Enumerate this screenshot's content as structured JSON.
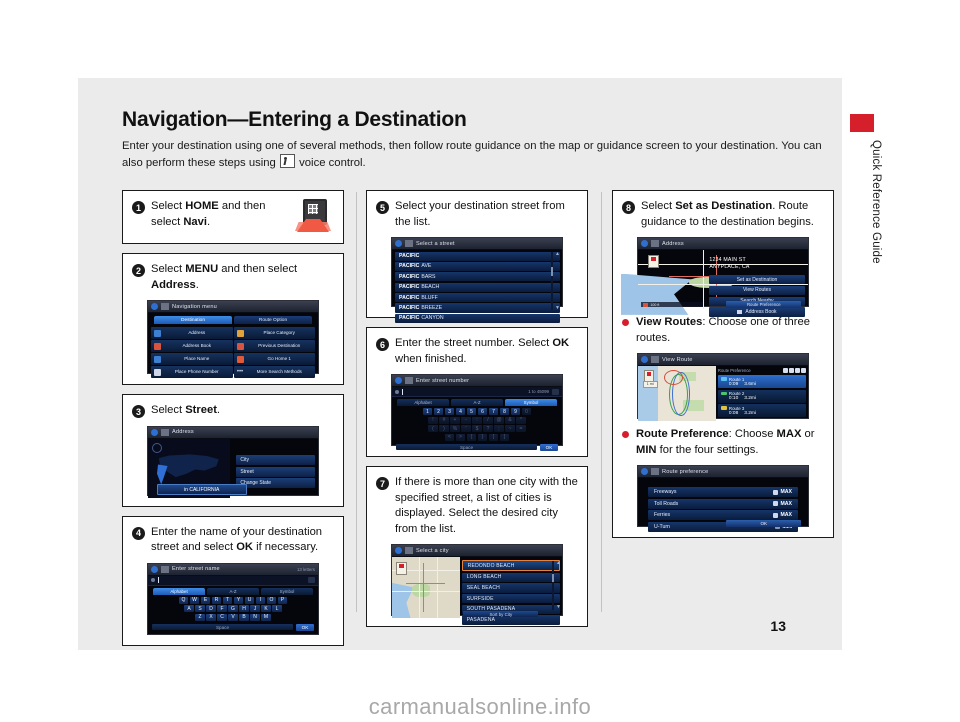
{
  "document": {
    "title": "Navigation—Entering a Destination",
    "intro": "Enter your destination using one of several methods, then follow route guidance on the map or guidance screen to your destination. You can also perform these steps using",
    "intro_tail": "voice control.",
    "page_number": "13",
    "sidebar_label": "Quick Reference Guide",
    "watermark": "carmanualsonline.info",
    "accent_red": "#d5202c"
  },
  "steps": {
    "s1": {
      "num": "1",
      "text_a": "Select ",
      "bold_a": "HOME",
      "text_b": " and then select ",
      "bold_b": "Navi",
      "text_c": "."
    },
    "s2": {
      "num": "2",
      "text_a": "Select ",
      "bold_a": "MENU",
      "text_b": " and then select ",
      "bold_b": "Address",
      "text_c": ".",
      "screen": {
        "title": "Navigation menu",
        "tabs": [
          "Destination",
          "Route Option"
        ],
        "active_tab": "Destination",
        "items": [
          "Address",
          "Place Category",
          "Address Book",
          "Previous Destination",
          "Place Name",
          "Go Home 1",
          "Place Phone Number",
          "More Search Methods"
        ]
      }
    },
    "s3": {
      "num": "3",
      "text_a": "Select ",
      "bold_a": "Street",
      "text_c": ".",
      "screen": {
        "title": "Address",
        "options": [
          "City",
          "Street",
          "Change State"
        ],
        "state_button": "in CALIFORNIA"
      }
    },
    "s4": {
      "num": "4",
      "text_a": "Enter the name of your destination street and select ",
      "bold_a": "OK",
      "text_c": " if necessary.",
      "screen": {
        "title": "Enter street name",
        "hint": "13 letters",
        "tabs": [
          "Alphabet",
          "A-Z",
          "Symbol"
        ],
        "active_tab": "Alphabet",
        "row1": [
          "Q",
          "W",
          "E",
          "R",
          "T",
          "Y",
          "U",
          "I",
          "O",
          "P"
        ],
        "row2": [
          "A",
          "S",
          "D",
          "F",
          "G",
          "H",
          "J",
          "K",
          "L"
        ],
        "row3": [
          "Z",
          "X",
          "C",
          "V",
          "B",
          "N",
          "M"
        ],
        "space_label": "Space",
        "ok_label": "OK"
      }
    },
    "s5": {
      "num": "5",
      "text_a": "Select your destination street from the list.",
      "screen": {
        "title": "Select a street",
        "rows": [
          {
            "bold": "PACIFIC",
            "rest": ""
          },
          {
            "bold": "PACIFIC",
            "rest": "AVE"
          },
          {
            "bold": "PACIFIC",
            "rest": "BARS"
          },
          {
            "bold": "PACIFIC",
            "rest": "BEACH"
          },
          {
            "bold": "PACIFIC",
            "rest": "BLUFF"
          },
          {
            "bold": "PACIFIC",
            "rest": "BREEZE"
          },
          {
            "bold": "PACIFIC",
            "rest": "CANYON"
          }
        ]
      }
    },
    "s6": {
      "num": "6",
      "text_a": "Enter the street number. Select ",
      "bold_a": "OK",
      "text_c": " when finished.",
      "screen": {
        "title": "Enter street number",
        "hint": "1 to 45099",
        "tabs": [
          "Alphabet",
          "A-Z",
          "Symbol"
        ],
        "active_tab": "Symbol",
        "row1": [
          "1",
          "2",
          "3",
          "4",
          "5",
          "6",
          "7",
          "8",
          "9",
          "0"
        ],
        "row2": [
          "!",
          "#",
          "+",
          "-",
          ":",
          "/",
          "@",
          "&",
          "*"
        ],
        "row3": [
          "(",
          ")",
          "%",
          "'",
          "$",
          "?",
          ";",
          "~",
          "="
        ],
        "row4": [
          "<",
          ">",
          "{",
          "}",
          "[",
          "]"
        ],
        "space_label": "Space",
        "ok_label": "OK"
      }
    },
    "s7": {
      "num": "7",
      "text_a": "If there is more than one city with the specified street, a list of cities is displayed. Select the desired city from the list.",
      "screen": {
        "title": "Select a city",
        "cities": [
          "REDONDO BEACH",
          "LONG BEACH",
          "SEAL BEACH",
          "SURFSIDE",
          "SOUTH PASADENA",
          "PASADENA"
        ],
        "selected": "REDONDO BEACH",
        "sort_button": "Sort by City"
      }
    },
    "s8": {
      "num": "8",
      "text_a": "Select ",
      "bold_a": "Set as Destination",
      "text_c": ". Route guidance to the destination begins.",
      "screen": {
        "title": "Address",
        "address_line1": "1234 MAIN ST",
        "address_line2": "ANYPLACE, CA",
        "options": [
          "Set as Destination",
          "View Routes",
          "Search Nearby",
          "Address Book"
        ],
        "pref_button": "Route Preference",
        "scale": "100 ft"
      },
      "bullet1": {
        "bold": "View Routes",
        "text": ": Choose one of three routes.",
        "screen": {
          "title": "View Route",
          "pref_label": "Route Preference",
          "zoom": "1 mi",
          "routes": [
            {
              "name": "Route 1",
              "time": "0:09",
              "distance": "3.6mi",
              "color": "#5bc0f0",
              "selected": true
            },
            {
              "name": "Route 2",
              "time": "0:10",
              "distance": "3.2mi",
              "color": "#4ec36a",
              "selected": false
            },
            {
              "name": "Route 3",
              "time": "0:08",
              "distance": "3.2mi",
              "color": "#e0c33c",
              "selected": false
            }
          ]
        }
      },
      "bullet2": {
        "bold": "Route Preference",
        "text_a": ": Choose ",
        "bold_b": "MAX",
        "text_b": " or ",
        "bold_c": "MIN",
        "text_c": " for the four settings.",
        "screen": {
          "title": "Route preference",
          "settings": [
            {
              "name": "Freeways",
              "value": "MAX"
            },
            {
              "name": "Toll Roads",
              "value": "MAX"
            },
            {
              "name": "Ferries",
              "value": "MAX"
            },
            {
              "name": "U-Turn",
              "value": "MIN"
            }
          ],
          "ok_label": "OK"
        }
      }
    }
  }
}
